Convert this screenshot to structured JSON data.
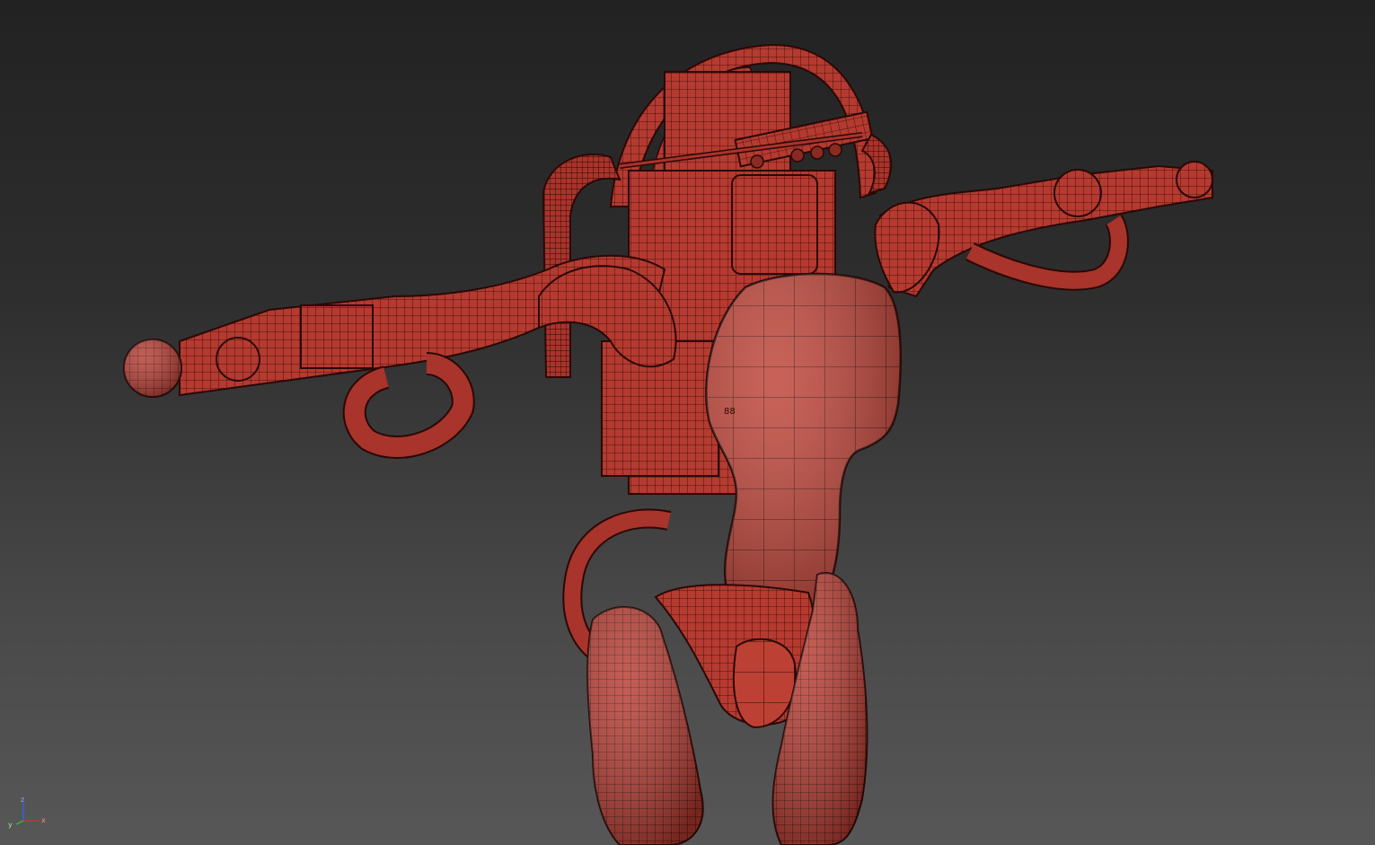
{
  "viewport": {
    "background_top": "#222222",
    "background_bottom": "#575757",
    "model_color": "#b83a30",
    "wire_color": "#2a0806"
  },
  "model_label": {
    "text": "88"
  },
  "axis_gizmo": {
    "z_label": "z",
    "y_label": "y",
    "x_label": "x",
    "x_color": "#d33030",
    "y_color": "#30c030",
    "z_color": "#3060ff"
  }
}
